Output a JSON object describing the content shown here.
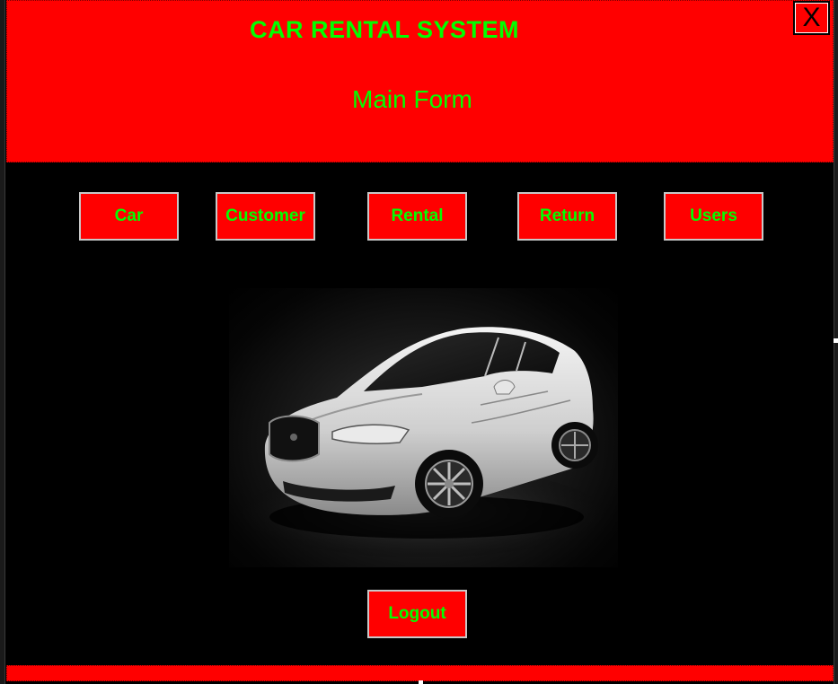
{
  "header": {
    "app_title": "CAR RENTAL SYSTEM",
    "form_title": "Main Form",
    "close_label": "X"
  },
  "nav": {
    "buttons": [
      {
        "label": "Car"
      },
      {
        "label": "Customer"
      },
      {
        "label": "Rental"
      },
      {
        "label": "Return"
      },
      {
        "label": "Users"
      }
    ]
  },
  "logout": {
    "label": "Logout"
  },
  "colors": {
    "header_bg": "#ff0000",
    "button_bg": "#ff0000",
    "text_green": "#00ff00",
    "window_bg": "#000000"
  },
  "icons": {
    "close": "close-icon",
    "car_picture": "car-image"
  }
}
